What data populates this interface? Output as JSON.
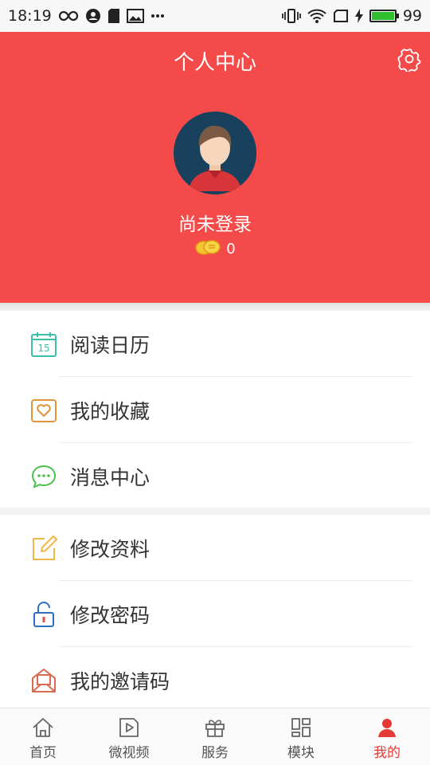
{
  "status_bar": {
    "time": "18:19",
    "battery_level": "99",
    "battery_fill_fraction": 0.99
  },
  "header": {
    "title": "个人中心",
    "login_status": "尚未登录",
    "coin_count": "0",
    "settings_icon": "gear-icon"
  },
  "menu_group_1": [
    {
      "label": "阅读日历",
      "icon": "calendar-icon",
      "color": "#3bbfa8"
    },
    {
      "label": "我的收藏",
      "icon": "favorite-heart-icon",
      "color": "#e0953a"
    },
    {
      "label": "消息中心",
      "icon": "message-bubble-icon",
      "color": "#4cc24c"
    }
  ],
  "menu_group_2": [
    {
      "label": "修改资料",
      "icon": "edit-icon",
      "color": "#f0b649"
    },
    {
      "label": "修改密码",
      "icon": "unlock-icon",
      "color": "#2e6fc4"
    },
    {
      "label": "我的邀请码",
      "icon": "invite-envelope-icon",
      "color": "#d9694f"
    }
  ],
  "tabbar": {
    "tabs": [
      {
        "label": "首页",
        "icon": "home-icon"
      },
      {
        "label": "微视频",
        "icon": "video-play-icon"
      },
      {
        "label": "服务",
        "icon": "gift-icon"
      },
      {
        "label": "模块",
        "icon": "modules-grid-icon"
      },
      {
        "label": "我的",
        "icon": "person-icon",
        "active": true
      }
    ],
    "active_color": "#e53935"
  },
  "colors": {
    "header_bg": "#f54a4a",
    "page_bg": "#f2f2f2"
  }
}
